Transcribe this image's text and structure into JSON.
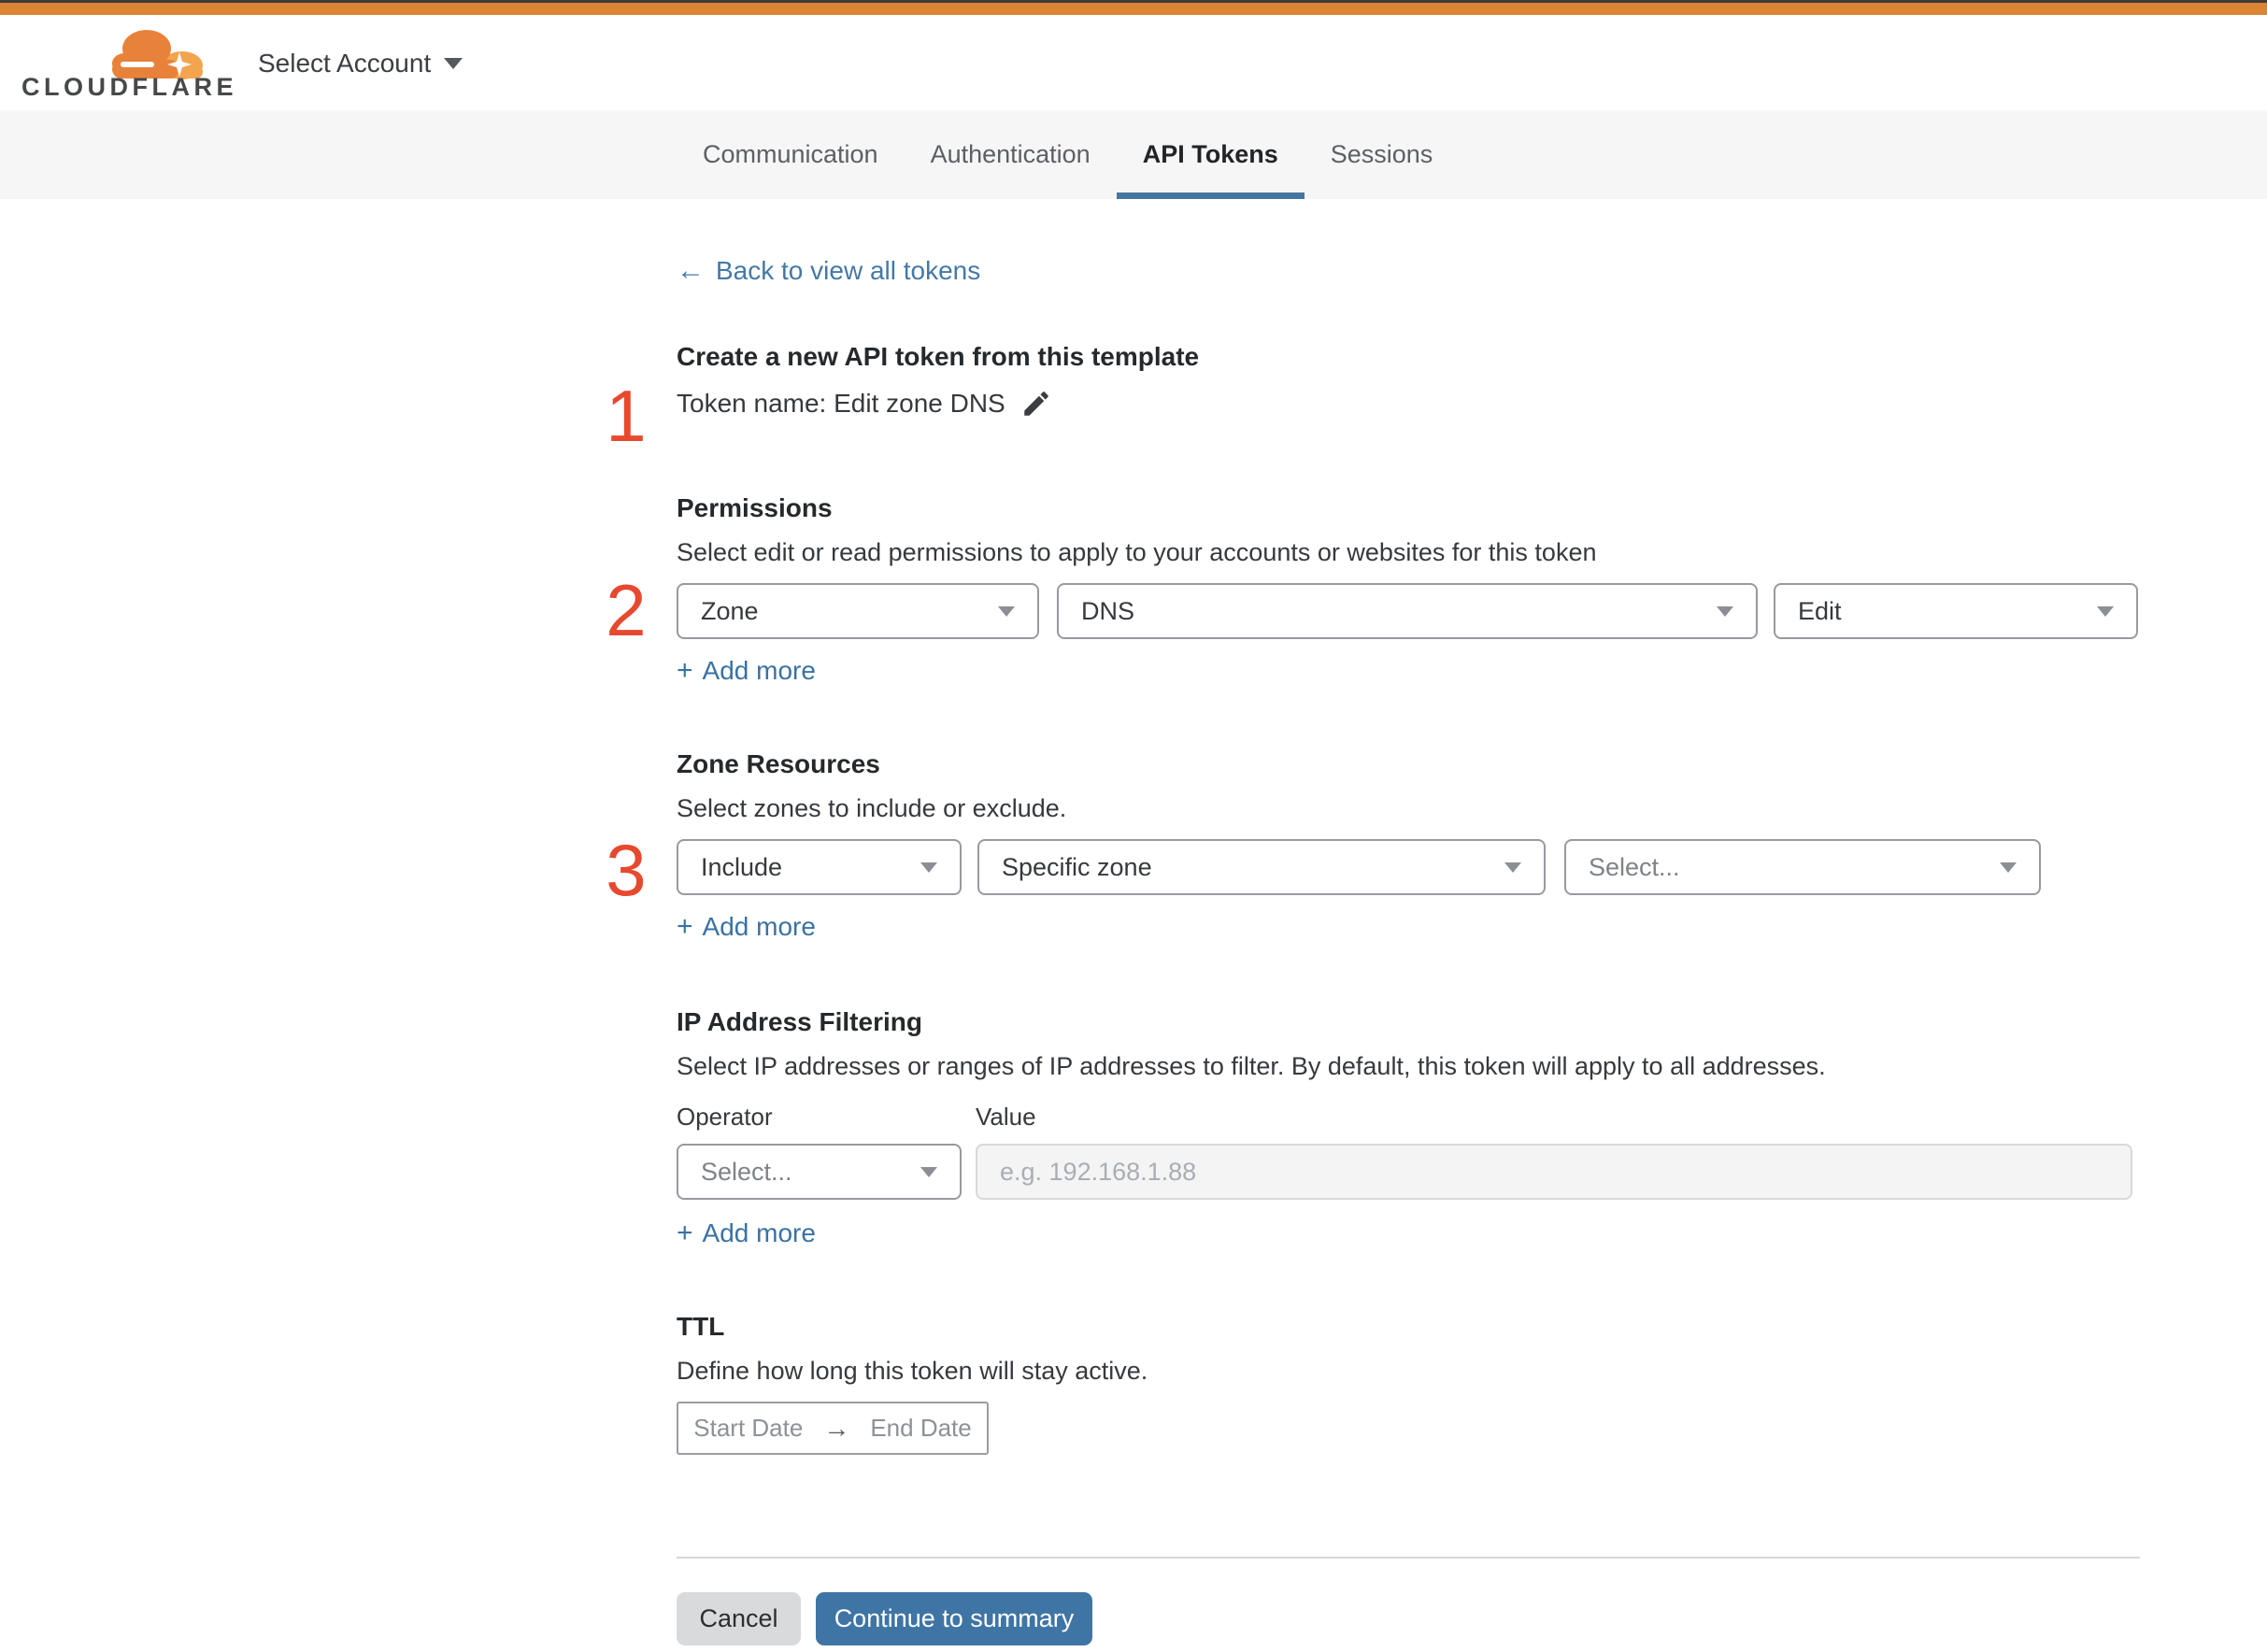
{
  "header": {
    "logo_text": "CLOUDFLARE",
    "account_selector": "Select Account"
  },
  "tabs": {
    "items": [
      {
        "label": "Communication",
        "active": false
      },
      {
        "label": "Authentication",
        "active": false
      },
      {
        "label": "API Tokens",
        "active": true
      },
      {
        "label": "Sessions",
        "active": false
      }
    ]
  },
  "back_link": {
    "arrow": "←",
    "label": "Back to view all tokens"
  },
  "annotations": {
    "step1": "1",
    "step2": "2",
    "step3": "3"
  },
  "token": {
    "title": "Create a new API token from this template",
    "name_line": "Token name: Edit zone DNS"
  },
  "permissions": {
    "heading": "Permissions",
    "description": "Select edit or read permissions to apply to your accounts or websites for this token",
    "scope_value": "Zone",
    "resource_value": "DNS",
    "access_value": "Edit",
    "add_more_label": "Add more",
    "plus": "+"
  },
  "zone_resources": {
    "heading": "Zone Resources",
    "description": "Select zones to include or exclude.",
    "operator_value": "Include",
    "type_value": "Specific zone",
    "zone_placeholder": "Select...",
    "add_more_label": "Add more",
    "plus": "+"
  },
  "ip_filtering": {
    "heading": "IP Address Filtering",
    "description": "Select IP addresses or ranges of IP addresses to filter. By default, this token will apply to all addresses.",
    "operator_label": "Operator",
    "value_label": "Value",
    "operator_placeholder": "Select...",
    "value_placeholder": "e.g. 192.168.1.88",
    "add_more_label": "Add more",
    "plus": "+"
  },
  "ttl": {
    "heading": "TTL",
    "description": "Define how long this token will stay active.",
    "start_label": "Start Date",
    "arrow": "→",
    "end_label": "End Date"
  },
  "footer": {
    "cancel_label": "Cancel",
    "continue_label": "Continue to summary"
  },
  "colors": {
    "topbar_orange": "#dd8433",
    "link_blue": "#4478a8",
    "button_blue": "#3f75a4",
    "active_tab_underline": "#44779f",
    "annotation_red": "#e7492f",
    "tabbar_background": "#f6f6f6"
  }
}
